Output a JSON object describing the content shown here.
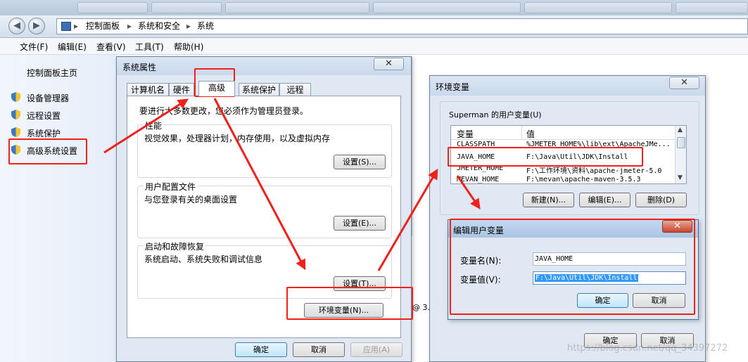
{
  "address_bar": {
    "crumbs": [
      "控制面板",
      "系统和安全",
      "系统"
    ]
  },
  "menu": [
    "文件(F)",
    "编辑(E)",
    "查看(V)",
    "工具(T)",
    "帮助(H)"
  ],
  "left_pane": {
    "home": "控制面板主页",
    "links": [
      "设备管理器",
      "远程设置",
      "系统保护",
      "高级系统设置"
    ]
  },
  "sys_props": {
    "title": "系统属性",
    "tabs": [
      "计算机名",
      "硬件",
      "高级",
      "系统保护",
      "远程"
    ],
    "admin_note": "要进行大多数更改，您必须作为管理员登录。",
    "perf": {
      "title": "性能",
      "desc": "视觉效果，处理器计划，内存使用，以及虚拟内存",
      "btn": "设置(S)..."
    },
    "profile": {
      "title": "用户配置文件",
      "desc": "与您登录有关的桌面设置",
      "btn": "设置(E)..."
    },
    "startup": {
      "title": "启动和故障恢复",
      "desc": "系统启动、系统失败和调试信息",
      "btn": "设置(T)..."
    },
    "env_btn": "环境变量(N)...",
    "ok": "确定",
    "cancel": "取消",
    "apply": "应用(A)"
  },
  "env_vars": {
    "title": "环境变量",
    "user_section": "Superman 的用户变量(U)",
    "col_var": "变量",
    "col_val": "值",
    "rows": [
      {
        "name": "CLASSPATH",
        "value": "%JMETER_HOME%\\lib\\ext\\ApacheJMe..."
      },
      {
        "name": "JAVA_HOME",
        "value": "F:\\Java\\Util\\JDK\\Install"
      },
      {
        "name": "JMETER_HOME",
        "value": "F:\\工作环境\\资料\\apache-jmeter-5.0"
      },
      {
        "name": "MEVAN_HOME",
        "value": "F:\\mevan\\apache-maven-3.5.3"
      }
    ],
    "new_btn": "新建(N)...",
    "edit_btn": "编辑(E)...",
    "delete_btn": "删除(D)",
    "ok": "确定",
    "cancel": "取消"
  },
  "edit_var": {
    "title": "编辑用户变量",
    "name_label": "变量名(N):",
    "name_value": "JAVA_HOME",
    "value_label": "变量值(V):",
    "value_value": "F:\\Java\\Util\\JDK\\Install",
    "ok": "确定",
    "cancel": "取消"
  },
  "background_fragment": "@ 3.",
  "watermark": "https://blog.csdn.net/qq_34397272",
  "colors": {
    "annotation_red": "#f0201a",
    "selection_blue": "#3399ff"
  }
}
